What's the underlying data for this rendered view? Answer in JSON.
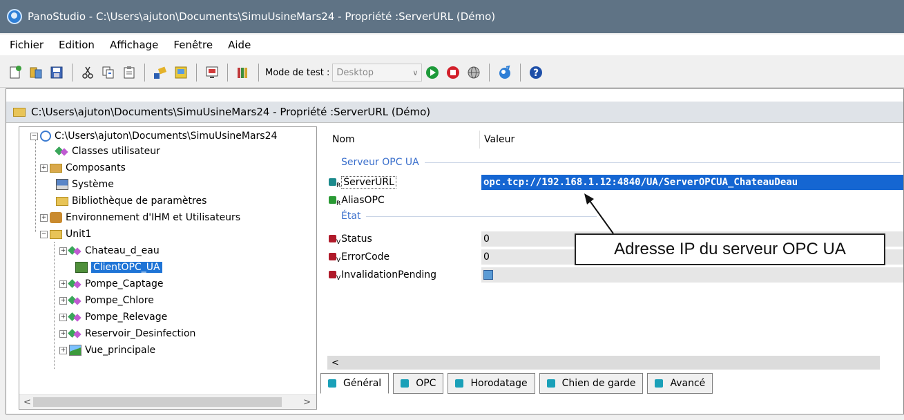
{
  "window": {
    "title": "PanoStudio - C:\\Users\\ajuton\\Documents\\SimuUsineMars24 - Propriété :ServerURL (Démo)"
  },
  "menu": [
    "Fichier",
    "Edition",
    "Affichage",
    "Fenêtre",
    "Aide"
  ],
  "toolbar": {
    "mode_label": "Mode de test :",
    "mode_value": "Desktop",
    "icons": [
      "new-icon",
      "open-icon",
      "save-icon",
      "cut-icon",
      "copy-icon",
      "paste-icon",
      "build-icon",
      "deploy-icon",
      "screen-icon",
      "library-icon",
      "play-icon",
      "stop-icon",
      "web-icon",
      "panostudio-icon",
      "help-icon"
    ]
  },
  "document": {
    "title": "C:\\Users\\ajuton\\Documents\\SimuUsineMars24 - Propriété :ServerURL (Démo)"
  },
  "tree": {
    "root": "C:\\Users\\ajuton\\Documents\\SimuUsineMars24",
    "items": [
      {
        "label": "Classes utilisateur",
        "icon": "class-icon"
      },
      {
        "label": "Composants",
        "icon": "components-icon"
      },
      {
        "label": "Système",
        "icon": "computer-icon"
      },
      {
        "label": "Bibliothèque de paramètres",
        "icon": "folder-icon"
      },
      {
        "label": "Environnement d'IHM et Utilisateurs",
        "icon": "users-icon"
      },
      {
        "label": "Unit1",
        "icon": "folder-icon"
      }
    ],
    "unit_children": [
      {
        "label": "Chateau_d_eau"
      },
      {
        "label": "ClientOPC_UA",
        "selected": true
      },
      {
        "label": "Pompe_Captage"
      },
      {
        "label": "Pompe_Chlore"
      },
      {
        "label": "Pompe_Relevage"
      },
      {
        "label": "Reservoir_Desinfection"
      },
      {
        "label": "Vue_principale"
      }
    ],
    "scroll_left": "<",
    "scroll_right": ">"
  },
  "properties": {
    "header": {
      "name": "Nom",
      "value": "Valeur"
    },
    "groups": [
      {
        "title": "Serveur OPC UA",
        "rows": [
          {
            "sub": "R",
            "name": "ServerURL",
            "value": "opc.tcp://192.168.1.12:4840/UA/ServerOPCUA_ChateauDeau",
            "selected": true
          },
          {
            "sub": "R",
            "name": "AliasOPC",
            "value": ""
          }
        ]
      },
      {
        "title": "État",
        "rows": [
          {
            "sub": "V",
            "name": "Status",
            "value": "0"
          },
          {
            "sub": "V",
            "name": "ErrorCode",
            "value": "0"
          },
          {
            "sub": "V",
            "name": "InvalidationPending",
            "value": "checkbox"
          }
        ]
      }
    ],
    "scroll_left": "<"
  },
  "tabs": [
    "Général",
    "OPC",
    "Horodatage",
    "Chien de garde",
    "Avancé"
  ],
  "annotation": "Adresse IP du serveur OPC UA"
}
